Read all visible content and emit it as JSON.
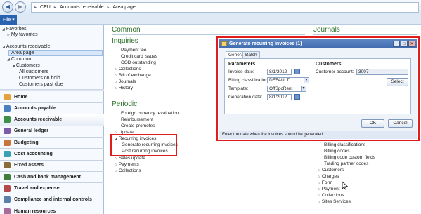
{
  "breadcrumb": [
    "CEU",
    "Accounts receivable",
    "Area page"
  ],
  "file_menu": "File",
  "nav": {
    "favorites": {
      "title": "Favorites",
      "items": [
        "My favorites"
      ]
    },
    "ar_tree": {
      "title": "Accounts receivable",
      "selected": "Area page",
      "common": "Common",
      "customers": "Customers",
      "customer_items": [
        "All customers",
        "Customers on hold",
        "Customers past due"
      ]
    },
    "modules": [
      {
        "label": "Home",
        "color": "#e3a23b"
      },
      {
        "label": "Accounts payable",
        "color": "#4a7fc1"
      },
      {
        "label": "Accounts receivable",
        "color": "#3c8f47"
      },
      {
        "label": "General ledger",
        "color": "#7d5aa8"
      },
      {
        "label": "Budgeting",
        "color": "#c9763a"
      },
      {
        "label": "Cost accounting",
        "color": "#3aa0b6"
      },
      {
        "label": "Fixed assets",
        "color": "#8a6b3a"
      },
      {
        "label": "Cash and bank management",
        "color": "#3f7f3a"
      },
      {
        "label": "Travel and expense",
        "color": "#b34a4a"
      },
      {
        "label": "Compliance and internal controls",
        "color": "#5a7fa8"
      },
      {
        "label": "Human resources",
        "color": "#a86a9c"
      }
    ]
  },
  "content": {
    "common": {
      "title": "Common"
    },
    "inquiries": {
      "title": "Inquiries",
      "links": [
        {
          "label": "Payment fee",
          "expand": false
        },
        {
          "label": "Credit card issues",
          "expand": false
        },
        {
          "label": "COD outstanding",
          "expand": false
        },
        {
          "label": "Collections",
          "expand": true
        },
        {
          "label": "Bill of exchange",
          "expand": true
        },
        {
          "label": "Journals",
          "expand": true
        },
        {
          "label": "History",
          "expand": true
        }
      ]
    },
    "periodic": {
      "title": "Periodic",
      "links": [
        {
          "label": "Foreign currency revaluation",
          "expand": false
        },
        {
          "label": "Reimbursement",
          "expand": false
        },
        {
          "label": "Create promotes",
          "expand": false
        },
        {
          "label": "Update",
          "expand": true
        }
      ],
      "recurring": {
        "label": "Recurring invoices",
        "children": [
          "Generate recurring invoices",
          "Post recurring invoices"
        ]
      },
      "links_after": [
        {
          "label": "Sales update",
          "expand": true
        },
        {
          "label": "Payments",
          "expand": true
        },
        {
          "label": "Collections",
          "expand": true
        }
      ]
    },
    "journals": {
      "title": "Journals",
      "links": [
        {
          "label": "Billing classifications",
          "expand": false
        },
        {
          "label": "Billing codes",
          "expand": false
        },
        {
          "label": "Billing code custom fields",
          "expand": false
        },
        {
          "label": "Trading partner codes",
          "expand": false
        },
        {
          "label": "Customers",
          "expand": true
        },
        {
          "label": "Charges",
          "expand": true
        },
        {
          "label": "Form",
          "expand": true
        },
        {
          "label": "Payment",
          "expand": true
        },
        {
          "label": "Collections",
          "expand": true
        },
        {
          "label": "Sites Services",
          "expand": true
        }
      ]
    }
  },
  "dialog": {
    "title": "Generate recurring invoices (1)",
    "tabs": [
      "General",
      "Batch"
    ],
    "parameters_title": "Parameters",
    "fields": {
      "invoice_date": {
        "label": "Invoice date:",
        "value": "8/1/2012"
      },
      "billing_classification": {
        "label": "Billing classification:",
        "value": "DEFAULT"
      },
      "template": {
        "label": "Template:",
        "value": "OffSpcRent"
      },
      "generation_date": {
        "label": "Generation date:",
        "value": "8/1/2012"
      }
    },
    "customers_title": "Customers",
    "customer_account": {
      "label": "Customer account:",
      "value": "3007"
    },
    "select_label": "Select",
    "ok_label": "OK",
    "cancel_label": "Cancel",
    "status": "Enter the date when the invoices should be generated"
  }
}
